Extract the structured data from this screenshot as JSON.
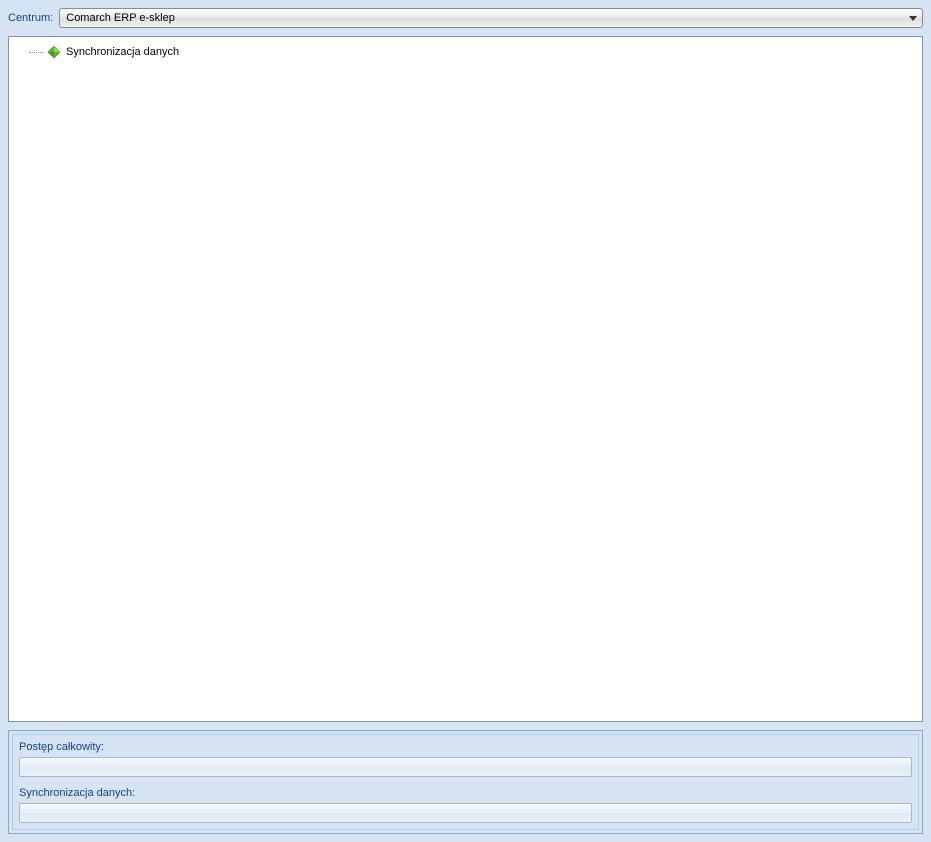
{
  "header": {
    "centrum_label": "Centrum:",
    "dropdown_value": "Comarch ERP e-sklep"
  },
  "tree": {
    "items": [
      {
        "label": "Synchronizacja danych",
        "icon": "green-diamond-icon"
      }
    ]
  },
  "progress": {
    "overall_label": "Postęp całkowity:",
    "sync_label": "Synchronizacja danych:"
  }
}
